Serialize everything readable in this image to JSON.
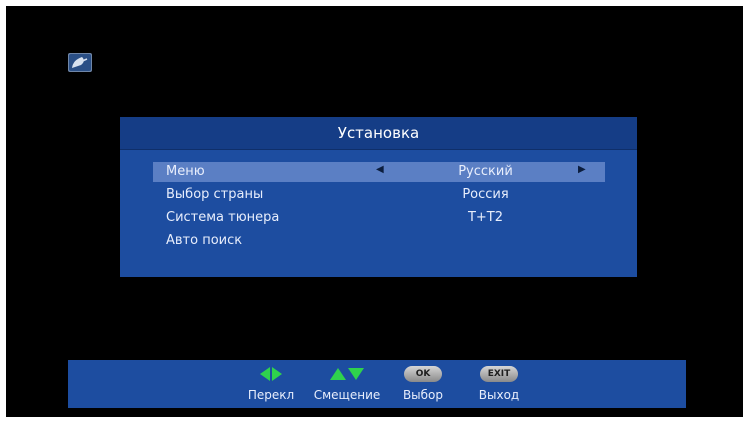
{
  "status_icon": "satellite-dish-icon",
  "dialog": {
    "title": "Установка",
    "rows": [
      {
        "label": "Меню",
        "value": "Русский",
        "selected": true
      },
      {
        "label": "Выбор страны",
        "value": "Россия",
        "selected": false
      },
      {
        "label": "Система тюнера",
        "value": "T+T2",
        "selected": false
      },
      {
        "label": "Авто поиск",
        "value": "",
        "selected": false
      }
    ],
    "arrow_left": "◀",
    "arrow_right": "▶"
  },
  "footer": {
    "hints": [
      {
        "icon": "left-right-arrows-icon",
        "label": "Перекл"
      },
      {
        "icon": "up-down-arrows-icon",
        "label": "Смещение"
      },
      {
        "icon": "ok-button-icon",
        "key": "OK",
        "label": "Выбор"
      },
      {
        "icon": "exit-button-icon",
        "key": "EXIT",
        "label": "Выход"
      }
    ]
  },
  "colors": {
    "panel": "#1d4da0",
    "title_bar": "#153d86",
    "highlight": "#5b7fc4",
    "arrow_green": "#2fd24d"
  }
}
